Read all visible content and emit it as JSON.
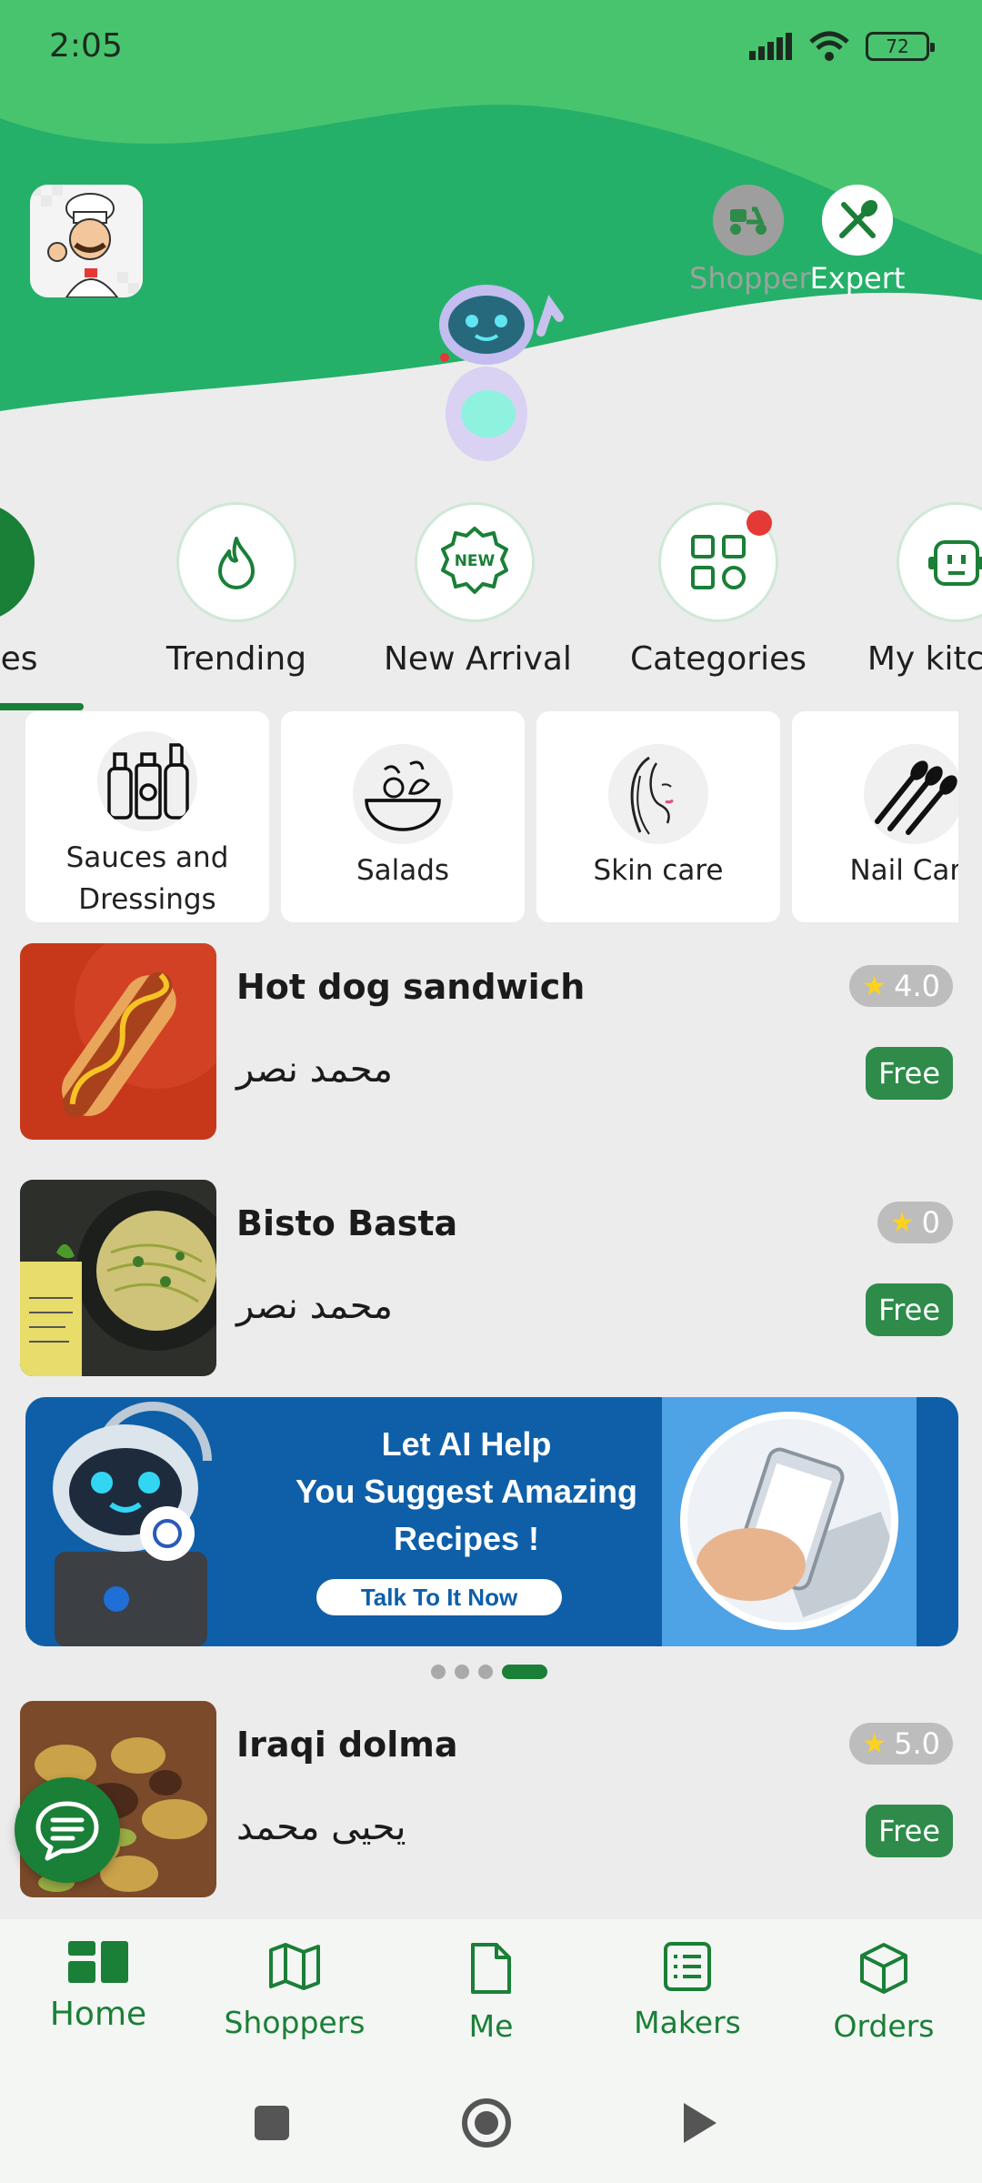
{
  "status_bar": {
    "time": "2:05",
    "battery": "72"
  },
  "header": {
    "shopper_label": "Shopper",
    "expert_label": "Expert"
  },
  "categories": [
    {
      "label": "Recipes",
      "icon": "clipboard-icon",
      "active": true
    },
    {
      "label": "Trending",
      "icon": "flame-icon"
    },
    {
      "label": "New Arrival",
      "icon": "new-badge-icon",
      "badge_text": "NEW"
    },
    {
      "label": "Categories",
      "icon": "grid-icon",
      "notification": true
    },
    {
      "label": "My kitchen",
      "icon": "robot-face-icon"
    }
  ],
  "subcategories": [
    {
      "label": "Sauces and Dressings"
    },
    {
      "label": "Salads"
    },
    {
      "label": "Skin care"
    },
    {
      "label": "Nail Care"
    }
  ],
  "recipes": [
    {
      "title": "Hot dog sandwich",
      "author": "محمد نصر",
      "rating": "4.0",
      "price": "Free"
    },
    {
      "title": "Bisto Basta",
      "author": "محمد نصر",
      "rating": "0",
      "price": "Free"
    },
    {
      "title": "Iraqi dolma",
      "author": "يحيى محمد",
      "rating": "5.0",
      "price": "Free"
    }
  ],
  "banner": {
    "line1": "Let AI Help",
    "line2": "You Suggest Amazing",
    "line3": "Recipes !",
    "cta": "Talk To It Now"
  },
  "carousel": {
    "count": 4,
    "active": 4
  },
  "bottom_nav": [
    {
      "label": "Home",
      "icon": "home-dashboard-icon",
      "active": true
    },
    {
      "label": "Shoppers",
      "icon": "map-icon"
    },
    {
      "label": "Me",
      "icon": "document-icon"
    },
    {
      "label": "Makers",
      "icon": "list-icon"
    },
    {
      "label": "Orders",
      "icon": "box-icon"
    }
  ],
  "colors": {
    "primary": "#1a7f37",
    "header_green": "#3fbf6a",
    "badge_red": "#e53935",
    "banner_blue": "#0e5fa8"
  }
}
